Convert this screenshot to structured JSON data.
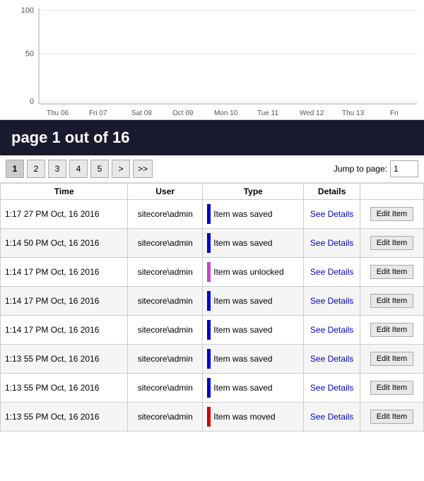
{
  "chart": {
    "yLabels": [
      "100",
      "50",
      "0"
    ],
    "xLabels": [
      "Thu 06",
      "Fri 07",
      "Sat 08",
      "Oct 09",
      "Mon 10",
      "Tue 11",
      "Wed 12",
      "Thu 13",
      "Fri"
    ]
  },
  "header": {
    "title": "page 1 out of 16"
  },
  "pagination": {
    "pages": [
      "1",
      "2",
      "3",
      "4",
      "5"
    ],
    "activePage": "1",
    "nextLabel": ">",
    "lastLabel": ">>",
    "jumpLabel": "Jump to page:",
    "jumpValue": "1"
  },
  "table": {
    "columns": [
      "Time",
      "User",
      "Type",
      "Details",
      ""
    ],
    "rows": [
      {
        "time": "1:17 27 PM Oct, 16 2016",
        "user": "sitecore\\admin",
        "type": "Item was saved",
        "barColor": "bar-blue",
        "seeDetails": "See Details",
        "editLabel": "Edit Item"
      },
      {
        "time": "1:14 50 PM Oct, 16 2016",
        "user": "sitecore\\admin",
        "type": "Item was saved",
        "barColor": "bar-blue",
        "seeDetails": "See Details",
        "editLabel": "Edit Item"
      },
      {
        "time": "1:14 17 PM Oct, 16 2016",
        "user": "sitecore\\admin",
        "type": "Item was unlocked",
        "barColor": "bar-pink",
        "seeDetails": "See Details",
        "editLabel": "Edit Item"
      },
      {
        "time": "1:14 17 PM Oct, 16 2016",
        "user": "sitecore\\admin",
        "type": "Item was saved",
        "barColor": "bar-blue",
        "seeDetails": "See Details",
        "editLabel": "Edit Item"
      },
      {
        "time": "1:14 17 PM Oct, 16 2016",
        "user": "sitecore\\admin",
        "type": "Item was saved",
        "barColor": "bar-blue",
        "seeDetails": "See Details",
        "editLabel": "Edit Item"
      },
      {
        "time": "1:13 55 PM Oct, 16 2016",
        "user": "sitecore\\admin",
        "type": "Item was saved",
        "barColor": "bar-blue",
        "seeDetails": "See Details",
        "editLabel": "Edit Item"
      },
      {
        "time": "1:13 55 PM Oct, 16 2016",
        "user": "sitecore\\admin",
        "type": "Item was saved",
        "barColor": "bar-blue",
        "seeDetails": "See Details",
        "editLabel": "Edit Item"
      },
      {
        "time": "1:13 55 PM Oct, 16 2016",
        "user": "sitecore\\admin",
        "type": "Item was moved",
        "barColor": "bar-red",
        "seeDetails": "See Details",
        "editLabel": "Edit Item"
      }
    ]
  }
}
